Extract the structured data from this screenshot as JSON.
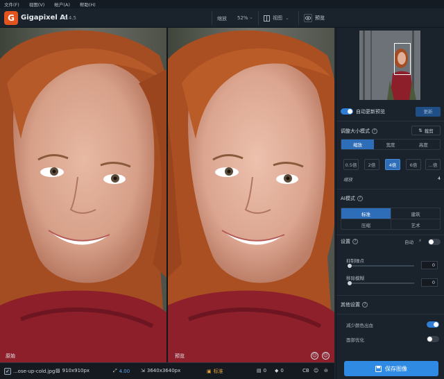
{
  "menu": [
    "文件(F)",
    "视图(V)",
    "帐户(A)",
    "帮助(H)"
  ],
  "app": {
    "logo_letter": "G",
    "name": "Gigapixel AI",
    "version": "v5.4.5"
  },
  "toolbar": {
    "zoom_label": "缩放",
    "zoom_value": "52%",
    "view_label": "视图",
    "preview_label": "预览"
  },
  "canvas": {
    "left_label": "原始",
    "right_label": "预览"
  },
  "statusbar": {
    "filename": "...ose-up-cold.jpg",
    "input_size": "910x910px",
    "scale": "4.00",
    "output_size": "3640x3640px",
    "model": "标准",
    "count_a": "0",
    "count_b": "0",
    "cb": "CB"
  },
  "sidebar": {
    "auto_update_label": "自动更新预览",
    "update_button": "更新",
    "resize_mode_title": "调整大小模式",
    "crop_button": "裁剪",
    "resize_tabs": [
      "缩放",
      "宽度",
      "高度"
    ],
    "resize_tab_active": 0,
    "multipliers": [
      "0.5倍",
      "2倍",
      "4倍",
      "6倍",
      "...倍"
    ],
    "multiplier_active": 2,
    "scale_label": "缩放",
    "scale_value": "4",
    "ai_mode_title": "AI模式",
    "ai_modes": [
      "标准",
      "建筑",
      "压缩",
      "艺术"
    ],
    "ai_mode_active": 0,
    "settings_title": "设置",
    "auto_label": "自动",
    "suppress_noise_label": "抑制噪点",
    "suppress_noise_value": "0",
    "remove_blur_label": "移除模糊",
    "remove_blur_value": "0",
    "other_settings_title": "其他设置",
    "reduce_color_bleed_label": "减少颜色出血",
    "face_refine_label": "面部优化",
    "save_button": "保存图像"
  },
  "colors": {
    "accent": "#2e7dd6",
    "save": "#2f8ae3",
    "logo": "#e2541d"
  }
}
